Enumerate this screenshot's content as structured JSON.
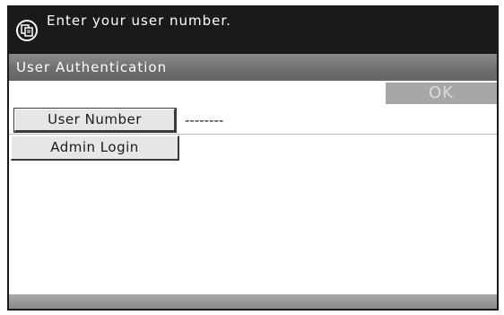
{
  "header": {
    "message": "Enter your user number.",
    "icon": "copier-icon"
  },
  "title_bar": {
    "title": "User Authentication"
  },
  "actions": {
    "ok_label": "OK"
  },
  "form": {
    "user_number_label": "User Number",
    "user_number_value": "--------",
    "admin_login_label": "Admin Login"
  },
  "colors": {
    "top_bar": "#1a1a1a",
    "title_bar": "#757575",
    "ok_disabled": "#a7a7a7"
  }
}
